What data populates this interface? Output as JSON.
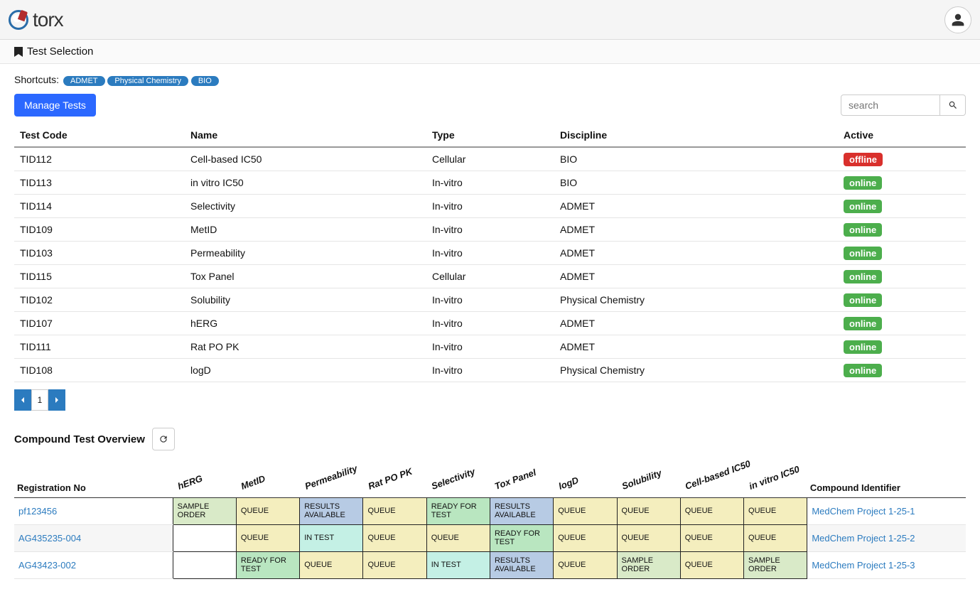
{
  "brand": "torx",
  "pageTitle": "Test Selection",
  "shortcuts": {
    "label": "Shortcuts:",
    "items": [
      "ADMET",
      "Physical Chemistry",
      "BIO"
    ]
  },
  "toolbar": {
    "manageTests": "Manage Tests",
    "searchPlaceholder": "search"
  },
  "testsTable": {
    "headers": {
      "code": "Test Code",
      "name": "Name",
      "type": "Type",
      "discipline": "Discipline",
      "active": "Active"
    },
    "rows": [
      {
        "code": "TID112",
        "name": "Cell-based IC50",
        "type": "Cellular",
        "discipline": "BIO",
        "active": "offline"
      },
      {
        "code": "TID113",
        "name": "in vitro IC50",
        "type": "In-vitro",
        "discipline": "BIO",
        "active": "online"
      },
      {
        "code": "TID114",
        "name": "Selectivity",
        "type": "In-vitro",
        "discipline": "ADMET",
        "active": "online"
      },
      {
        "code": "TID109",
        "name": "MetID",
        "type": "In-vitro",
        "discipline": "ADMET",
        "active": "online"
      },
      {
        "code": "TID103",
        "name": "Permeability",
        "type": "In-vitro",
        "discipline": "ADMET",
        "active": "online"
      },
      {
        "code": "TID115",
        "name": "Tox Panel",
        "type": "Cellular",
        "discipline": "ADMET",
        "active": "online"
      },
      {
        "code": "TID102",
        "name": "Solubility",
        "type": "In-vitro",
        "discipline": "Physical Chemistry",
        "active": "online"
      },
      {
        "code": "TID107",
        "name": "hERG",
        "type": "In-vitro",
        "discipline": "ADMET",
        "active": "online"
      },
      {
        "code": "TID111",
        "name": "Rat PO PK",
        "type": "In-vitro",
        "discipline": "ADMET",
        "active": "online"
      },
      {
        "code": "TID108",
        "name": "logD",
        "type": "In-vitro",
        "discipline": "Physical Chemistry",
        "active": "online"
      }
    ]
  },
  "pagination": {
    "page": "1"
  },
  "overview": {
    "title": "Compound Test Overview",
    "headers": {
      "reg": "Registration No",
      "tests": [
        "hERG",
        "MetID",
        "Permeability",
        "Rat PO PK",
        "Selectivity",
        "Tox Panel",
        "logD",
        "Solubility",
        "Cell-based IC50",
        "in vitro IC50"
      ],
      "cid": "Compound Identifier"
    },
    "statusLabels": {
      "sample-order": "SAMPLE ORDER",
      "queue": "QUEUE",
      "results-available": "RESULTS AVAILABLE",
      "ready-for-test": "READY FOR TEST",
      "in-test": "IN TEST",
      "empty": ""
    },
    "rows": [
      {
        "reg": "pf123456",
        "cells": [
          "sample-order",
          "queue",
          "results-available",
          "queue",
          "ready-for-test",
          "results-available",
          "queue",
          "queue",
          "queue",
          "queue"
        ],
        "cid": "MedChem Project 1-25-1"
      },
      {
        "reg": "AG435235-004",
        "cells": [
          "empty",
          "queue",
          "in-test",
          "queue",
          "queue",
          "ready-for-test",
          "queue",
          "queue",
          "queue",
          "queue"
        ],
        "cid": "MedChem Project 1-25-2"
      },
      {
        "reg": "AG43423-002",
        "cells": [
          "empty",
          "ready-for-test",
          "queue",
          "queue",
          "in-test",
          "results-available",
          "queue",
          "sample-order",
          "queue",
          "sample-order"
        ],
        "cid": "MedChem Project 1-25-3"
      }
    ]
  }
}
